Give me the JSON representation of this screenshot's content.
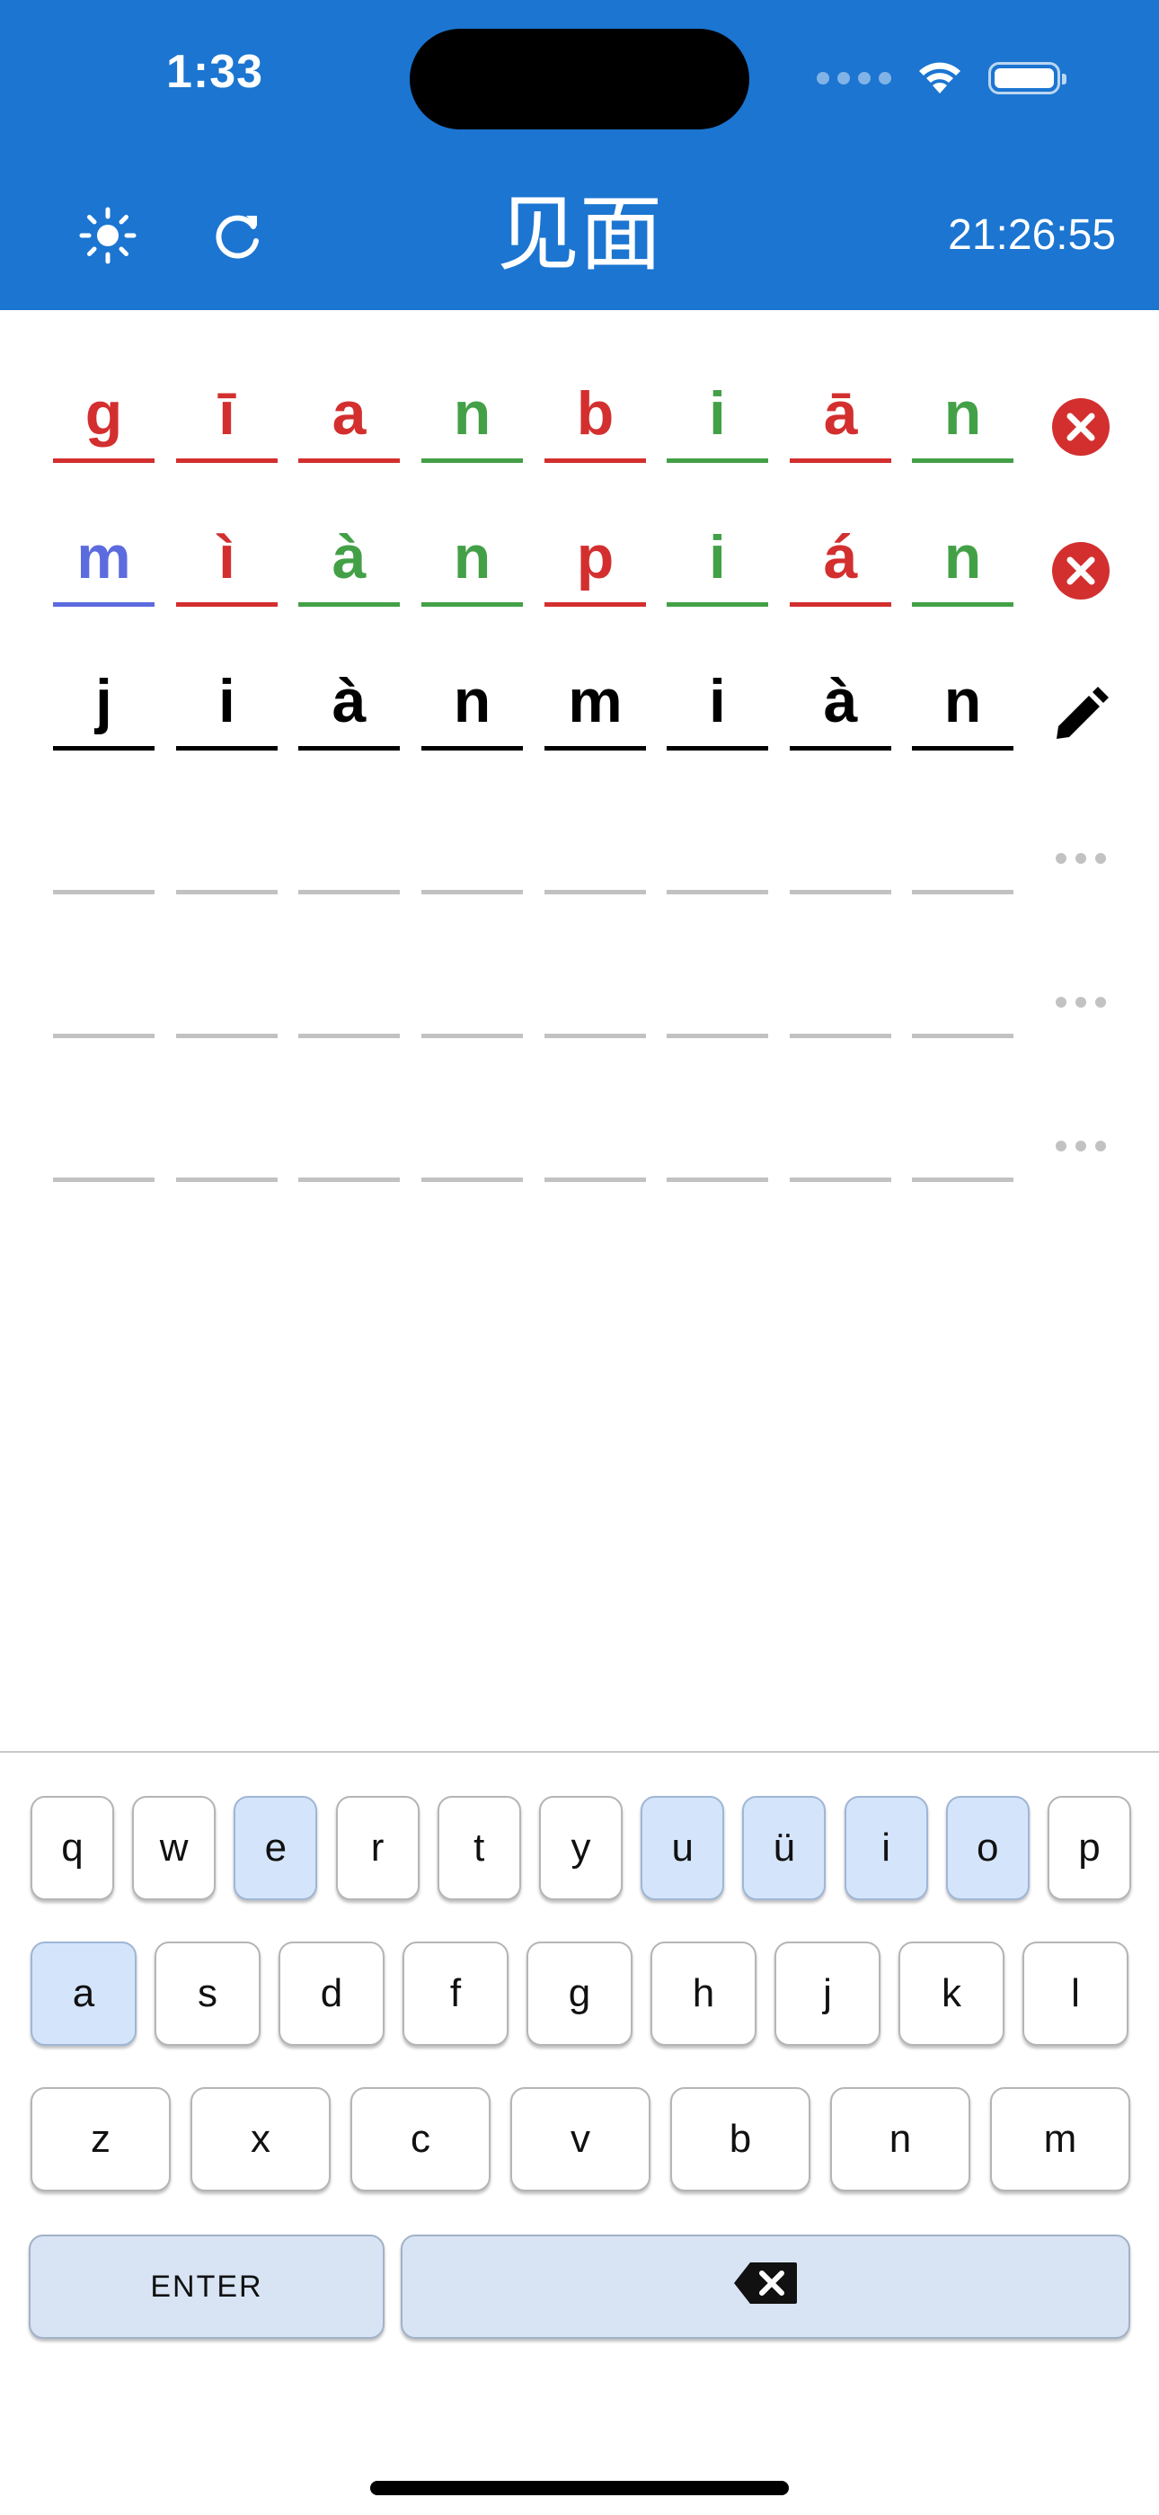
{
  "status_bar": {
    "time": "1:33"
  },
  "header": {
    "title": "见面",
    "clock": "21:26:55",
    "theme_icon": "sun-icon",
    "refresh_icon": "refresh-icon",
    "background_color": "#1b75d1"
  },
  "colors": {
    "wrong": "#d32f2f",
    "correct": "#43a047",
    "misplaced": "#5c6bde",
    "current": "#000000",
    "empty": "#c2c2c2",
    "vowel_key": "#d4e5fb"
  },
  "guesses": [
    {
      "status_icon": "x-circle-icon",
      "letters": [
        {
          "char": "g",
          "state": "red"
        },
        {
          "char": "ī",
          "state": "red"
        },
        {
          "char": "a",
          "state": "red"
        },
        {
          "char": "n",
          "state": "green"
        },
        {
          "char": "b",
          "state": "red"
        },
        {
          "char": "i",
          "state": "green"
        },
        {
          "char": "ā",
          "state": "red"
        },
        {
          "char": "n",
          "state": "green"
        }
      ]
    },
    {
      "status_icon": "x-circle-icon",
      "letters": [
        {
          "char": "m",
          "state": "blue"
        },
        {
          "char": "ì",
          "state": "red"
        },
        {
          "char": "à",
          "state": "green"
        },
        {
          "char": "n",
          "state": "green"
        },
        {
          "char": "p",
          "state": "red"
        },
        {
          "char": "i",
          "state": "green"
        },
        {
          "char": "á",
          "state": "red"
        },
        {
          "char": "n",
          "state": "green"
        }
      ]
    },
    {
      "status_icon": "pencil-icon",
      "letters": [
        {
          "char": "j",
          "state": "black"
        },
        {
          "char": "i",
          "state": "black"
        },
        {
          "char": "à",
          "state": "black"
        },
        {
          "char": "n",
          "state": "black"
        },
        {
          "char": "m",
          "state": "black"
        },
        {
          "char": "i",
          "state": "black"
        },
        {
          "char": "à",
          "state": "black"
        },
        {
          "char": "n",
          "state": "black"
        }
      ]
    },
    {
      "status_icon": "more-dots-icon",
      "letters": [
        {
          "char": "",
          "state": "empty"
        },
        {
          "char": "",
          "state": "empty"
        },
        {
          "char": "",
          "state": "empty"
        },
        {
          "char": "",
          "state": "empty"
        },
        {
          "char": "",
          "state": "empty"
        },
        {
          "char": "",
          "state": "empty"
        },
        {
          "char": "",
          "state": "empty"
        },
        {
          "char": "",
          "state": "empty"
        }
      ]
    },
    {
      "status_icon": "more-dots-icon",
      "letters": [
        {
          "char": "",
          "state": "empty"
        },
        {
          "char": "",
          "state": "empty"
        },
        {
          "char": "",
          "state": "empty"
        },
        {
          "char": "",
          "state": "empty"
        },
        {
          "char": "",
          "state": "empty"
        },
        {
          "char": "",
          "state": "empty"
        },
        {
          "char": "",
          "state": "empty"
        },
        {
          "char": "",
          "state": "empty"
        }
      ]
    },
    {
      "status_icon": "more-dots-icon",
      "letters": [
        {
          "char": "",
          "state": "empty"
        },
        {
          "char": "",
          "state": "empty"
        },
        {
          "char": "",
          "state": "empty"
        },
        {
          "char": "",
          "state": "empty"
        },
        {
          "char": "",
          "state": "empty"
        },
        {
          "char": "",
          "state": "empty"
        },
        {
          "char": "",
          "state": "empty"
        },
        {
          "char": "",
          "state": "empty"
        }
      ]
    }
  ],
  "keyboard": {
    "rows": [
      [
        {
          "label": "q",
          "vowel": false
        },
        {
          "label": "w",
          "vowel": false
        },
        {
          "label": "e",
          "vowel": true
        },
        {
          "label": "r",
          "vowel": false
        },
        {
          "label": "t",
          "vowel": false
        },
        {
          "label": "y",
          "vowel": false
        },
        {
          "label": "u",
          "vowel": true
        },
        {
          "label": "ü",
          "vowel": true
        },
        {
          "label": "i",
          "vowel": true
        },
        {
          "label": "o",
          "vowel": true
        },
        {
          "label": "p",
          "vowel": false
        }
      ],
      [
        {
          "label": "a",
          "vowel": true
        },
        {
          "label": "s",
          "vowel": false
        },
        {
          "label": "d",
          "vowel": false
        },
        {
          "label": "f",
          "vowel": false
        },
        {
          "label": "g",
          "vowel": false
        },
        {
          "label": "h",
          "vowel": false
        },
        {
          "label": "j",
          "vowel": false
        },
        {
          "label": "k",
          "vowel": false
        },
        {
          "label": "l",
          "vowel": false
        }
      ],
      [
        {
          "label": "z",
          "vowel": false
        },
        {
          "label": "x",
          "vowel": false
        },
        {
          "label": "c",
          "vowel": false
        },
        {
          "label": "v",
          "vowel": false
        },
        {
          "label": "b",
          "vowel": false
        },
        {
          "label": "n",
          "vowel": false
        },
        {
          "label": "m",
          "vowel": false
        }
      ]
    ],
    "enter_label": "ENTER",
    "backspace_icon": "backspace-icon"
  }
}
